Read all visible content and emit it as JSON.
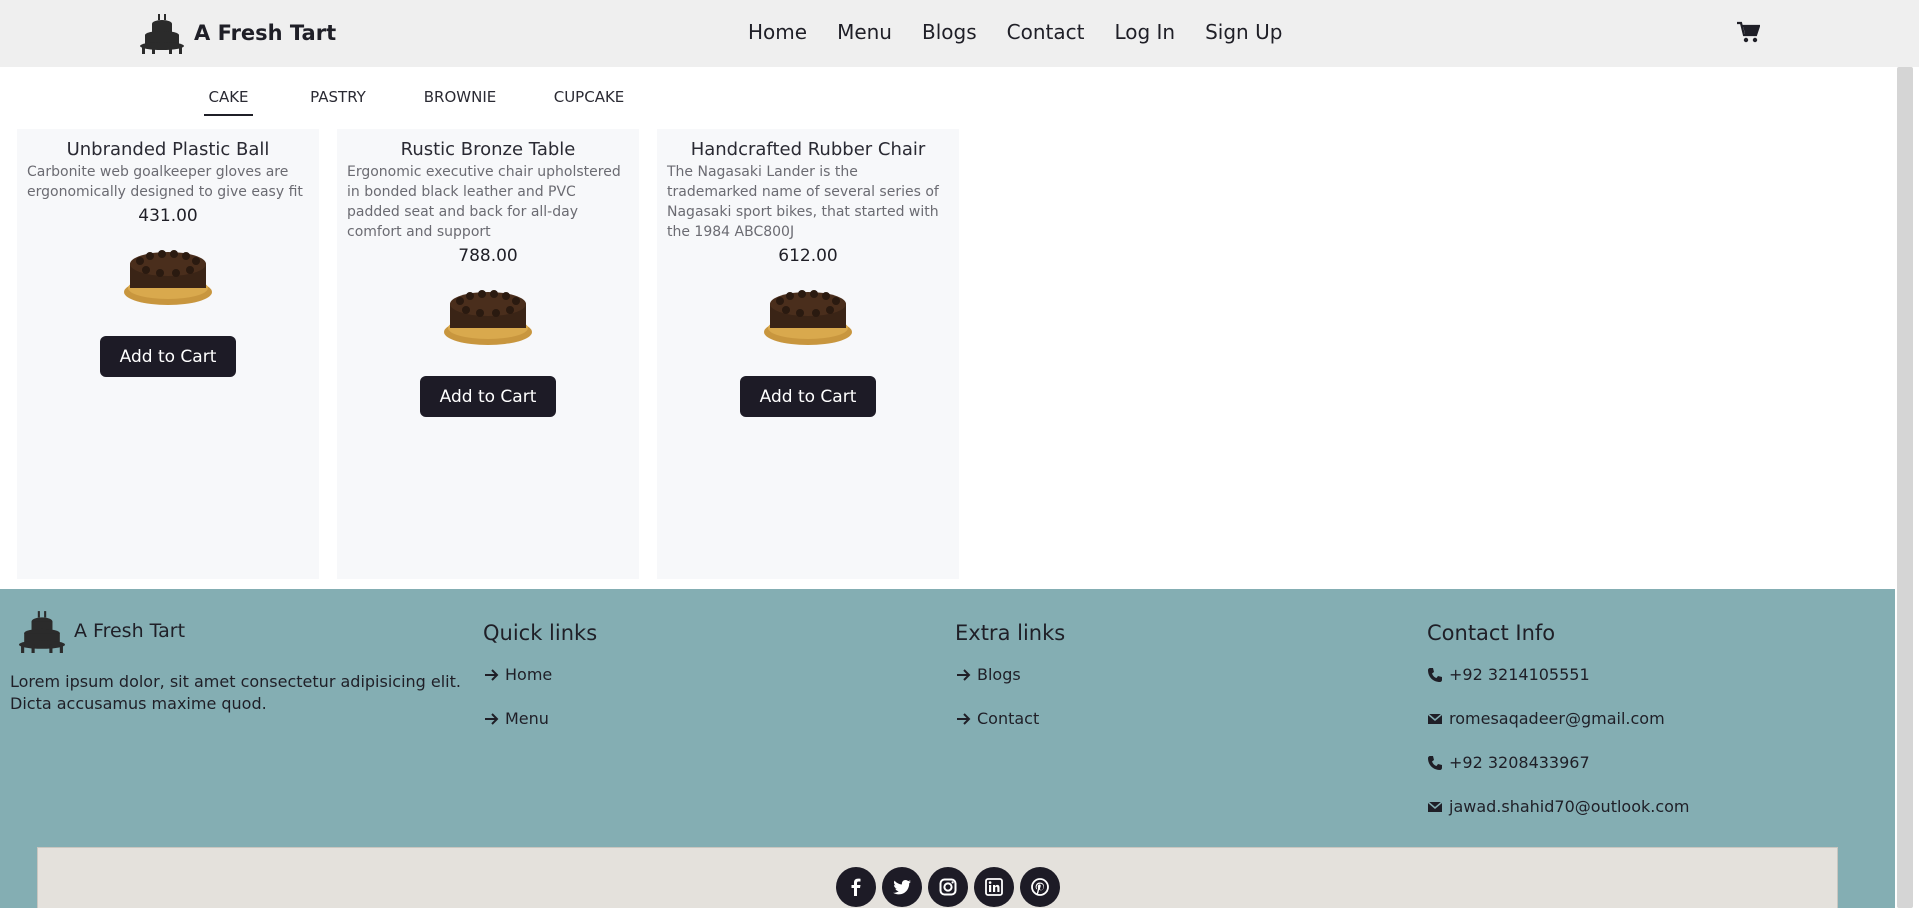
{
  "header": {
    "brand": "A Fresh Tart",
    "nav": [
      "Home",
      "Menu",
      "Blogs",
      "Contact",
      "Log In",
      "Sign Up"
    ]
  },
  "tabs": [
    {
      "label": "CAKE",
      "active": true
    },
    {
      "label": "PASTRY",
      "active": false
    },
    {
      "label": "BROWNIE",
      "active": false
    },
    {
      "label": "CUPCAKE",
      "active": false
    }
  ],
  "products": [
    {
      "title": "Unbranded Plastic Ball",
      "description": "Carbonite web goalkeeper gloves are ergonomically designed to give easy fit",
      "price": "431.00",
      "button": "Add to Cart"
    },
    {
      "title": "Rustic Bronze Table",
      "description": "Ergonomic executive chair upholstered in bonded black leather and PVC padded seat and back for all-day comfort and support",
      "price": "788.00",
      "button": "Add to Cart"
    },
    {
      "title": "Handcrafted Rubber Chair",
      "description": "The Nagasaki Lander is the trademarked name of several series of Nagasaki sport bikes, that started with the 1984 ABC800J",
      "price": "612.00",
      "button": "Add to Cart"
    }
  ],
  "footer": {
    "brand": "A Fresh Tart",
    "about": "Lorem ipsum dolor, sit amet consectetur adipisicing elit. Dicta accusamus maxime quod.",
    "quick_links": {
      "title": "Quick links",
      "items": [
        "Home",
        "Menu"
      ]
    },
    "extra_links": {
      "title": "Extra links",
      "items": [
        "Blogs",
        "Contact"
      ]
    },
    "contact": {
      "title": "Contact Info",
      "items": [
        {
          "icon": "phone-icon",
          "text": "+92 3214105551"
        },
        {
          "icon": "envelope-icon",
          "text": "romesaqadeer@gmail.com"
        },
        {
          "icon": "phone-icon",
          "text": "+92 3208433967"
        },
        {
          "icon": "envelope-icon",
          "text": "jawad.shahid70@outlook.com"
        }
      ]
    },
    "socials": [
      "facebook-icon",
      "twitter-icon",
      "instagram-icon",
      "linkedin-icon",
      "pinterest-icon"
    ]
  },
  "colors": {
    "header_bg": "#efefef",
    "card_bg": "#f7f8fa",
    "button_bg": "#1d1b26",
    "footer_bg": "#84aeb3",
    "social_bar_bg": "#e4e1dc"
  }
}
